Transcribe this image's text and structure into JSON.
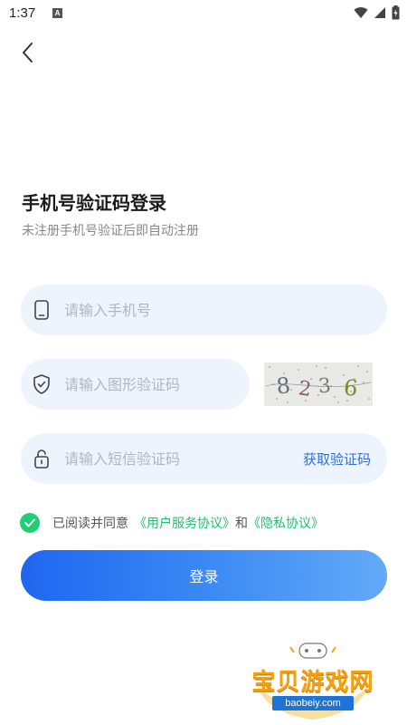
{
  "status_bar": {
    "time": "1:37",
    "notification_letter": "A"
  },
  "login": {
    "title": "手机号验证码登录",
    "subtitle": "未注册手机号验证后即自动注册",
    "phone_placeholder": "请输入手机号",
    "captcha_placeholder": "请输入图形验证码",
    "captcha_image_text": "8236",
    "sms_placeholder": "请输入短信验证码",
    "get_code_label": "获取验证码",
    "agree_prefix": "已阅读并同意",
    "user_agreement_link": "《用户服务协议》",
    "agree_and": "和",
    "privacy_link": "《隐私协议》",
    "login_button": "登录"
  },
  "watermark": {
    "text": "宝贝游戏网",
    "url": "baobeiy.com"
  },
  "colors": {
    "accent": "#2f6fd6",
    "link_green": "#1dbf70",
    "field_bg": "#edf4fe"
  }
}
